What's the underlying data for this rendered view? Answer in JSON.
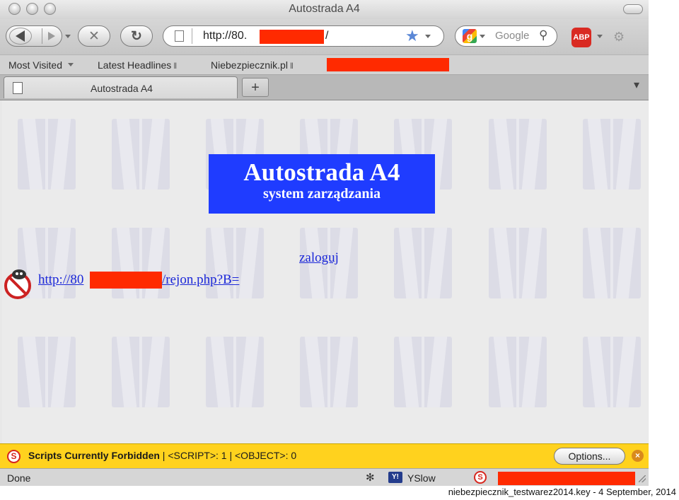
{
  "window": {
    "title": "Autostrada A4"
  },
  "toolbar": {
    "url_prefix": "http://80.",
    "url_suffix": "/",
    "search_placeholder": "Google",
    "abp_label": "ABP"
  },
  "bookmarks": {
    "items": [
      {
        "label": "Most Visited",
        "has_dropdown": true,
        "rss": false
      },
      {
        "label": "Latest Headlines",
        "has_dropdown": false,
        "rss": true
      },
      {
        "label": "Niebezpiecznik.pl",
        "has_dropdown": false,
        "rss": true
      }
    ]
  },
  "tabs": [
    {
      "label": "Autostrada A4"
    }
  ],
  "newtab_label": "+",
  "page": {
    "banner_title": "Autostrada A4",
    "banner_subtitle": "system zarządzania",
    "login_link": "zaloguj",
    "url_link_prefix": "http://80",
    "url_link_suffix": "/rejon.php?B="
  },
  "noscript_bar": {
    "message_bold": "Scripts Currently Forbidden",
    "message_rest": " | <SCRIPT>: 1 | <OBJECT>: 0",
    "options_label": "Options..."
  },
  "statusbar": {
    "status_text": "Done",
    "yslow_label": "YSlow"
  },
  "footer": "niebezpiecznik_testwarez2014.key - 4 September, 2014",
  "colors": {
    "banner_bg": "#1f3cff",
    "link": "#1b27d8",
    "noscript_bar": "#ffd21e",
    "redaction": "#ff2a00"
  }
}
